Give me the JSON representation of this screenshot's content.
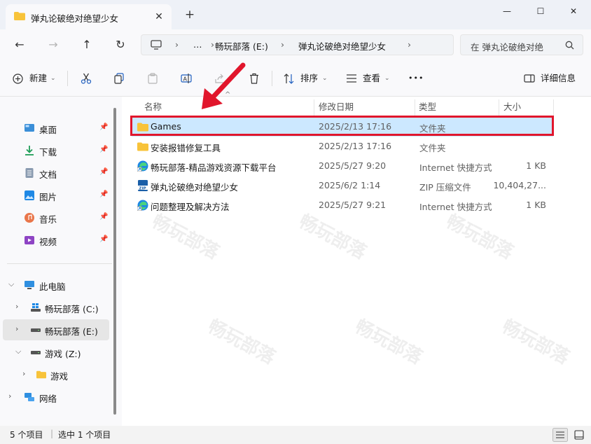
{
  "window": {
    "tab_title": "弹丸论破绝对绝望少女",
    "tab_close": "✕",
    "new_tab": "+",
    "minimize": "—",
    "maximize": "☐",
    "close": "✕"
  },
  "nav": {
    "back": "←",
    "forward": "→",
    "up": "↑",
    "refresh": "↻",
    "breadcrumb": [
      "…",
      "畅玩部落 (E:)",
      "弹丸论破绝对绝望少女"
    ],
    "search_placeholder": "在 弹丸论破绝对绝"
  },
  "toolbar": {
    "new_label": "新建",
    "sort_label": "排序",
    "view_label": "查看",
    "more": "•••",
    "details_label": "详细信息"
  },
  "sidebar": {
    "quick": [
      {
        "label": "桌面",
        "icon": "desktop-icon"
      },
      {
        "label": "下载",
        "icon": "download-icon"
      },
      {
        "label": "文档",
        "icon": "document-icon"
      },
      {
        "label": "图片",
        "icon": "picture-icon"
      },
      {
        "label": "音乐",
        "icon": "music-icon"
      },
      {
        "label": "视频",
        "icon": "video-icon"
      }
    ],
    "this_pc": "此电脑",
    "drive_c": "畅玩部落 (C:)",
    "drive_e": "畅玩部落 (E:)",
    "drive_z": "游戏 (Z:)",
    "folder_games": "游戏",
    "network": "网络"
  },
  "columns": {
    "name": "名称",
    "date": "修改日期",
    "type": "类型",
    "size": "大小"
  },
  "files": [
    {
      "name": "Games",
      "date": "2025/2/13 17:16",
      "type": "文件夹",
      "size": "",
      "icon": "folder-icon",
      "selected": true
    },
    {
      "name": "安装报错修复工具",
      "date": "2025/2/13 17:16",
      "type": "文件夹",
      "size": "",
      "icon": "folder-icon"
    },
    {
      "name": "畅玩部落-精品游戏资源下载平台",
      "date": "2025/5/27 9:20",
      "type": "Internet 快捷方式",
      "size": "1 KB",
      "icon": "edge-shortcut-icon"
    },
    {
      "name": "弹丸论破绝对绝望少女",
      "date": "2025/6/2 1:14",
      "type": "ZIP 压缩文件",
      "size": "10,404,27...",
      "icon": "zip-icon"
    },
    {
      "name": "问题整理及解决方法",
      "date": "2025/5/27 9:21",
      "type": "Internet 快捷方式",
      "size": "1 KB",
      "icon": "edge-shortcut-icon"
    }
  ],
  "status": {
    "item_count": "5 个项目",
    "selected": "选中 1 个项目"
  },
  "colors": {
    "highlight_border": "#e1162c",
    "selection_bg": "#cce8ff",
    "arrow": "#e1162c",
    "folder": "#f8c33a"
  }
}
